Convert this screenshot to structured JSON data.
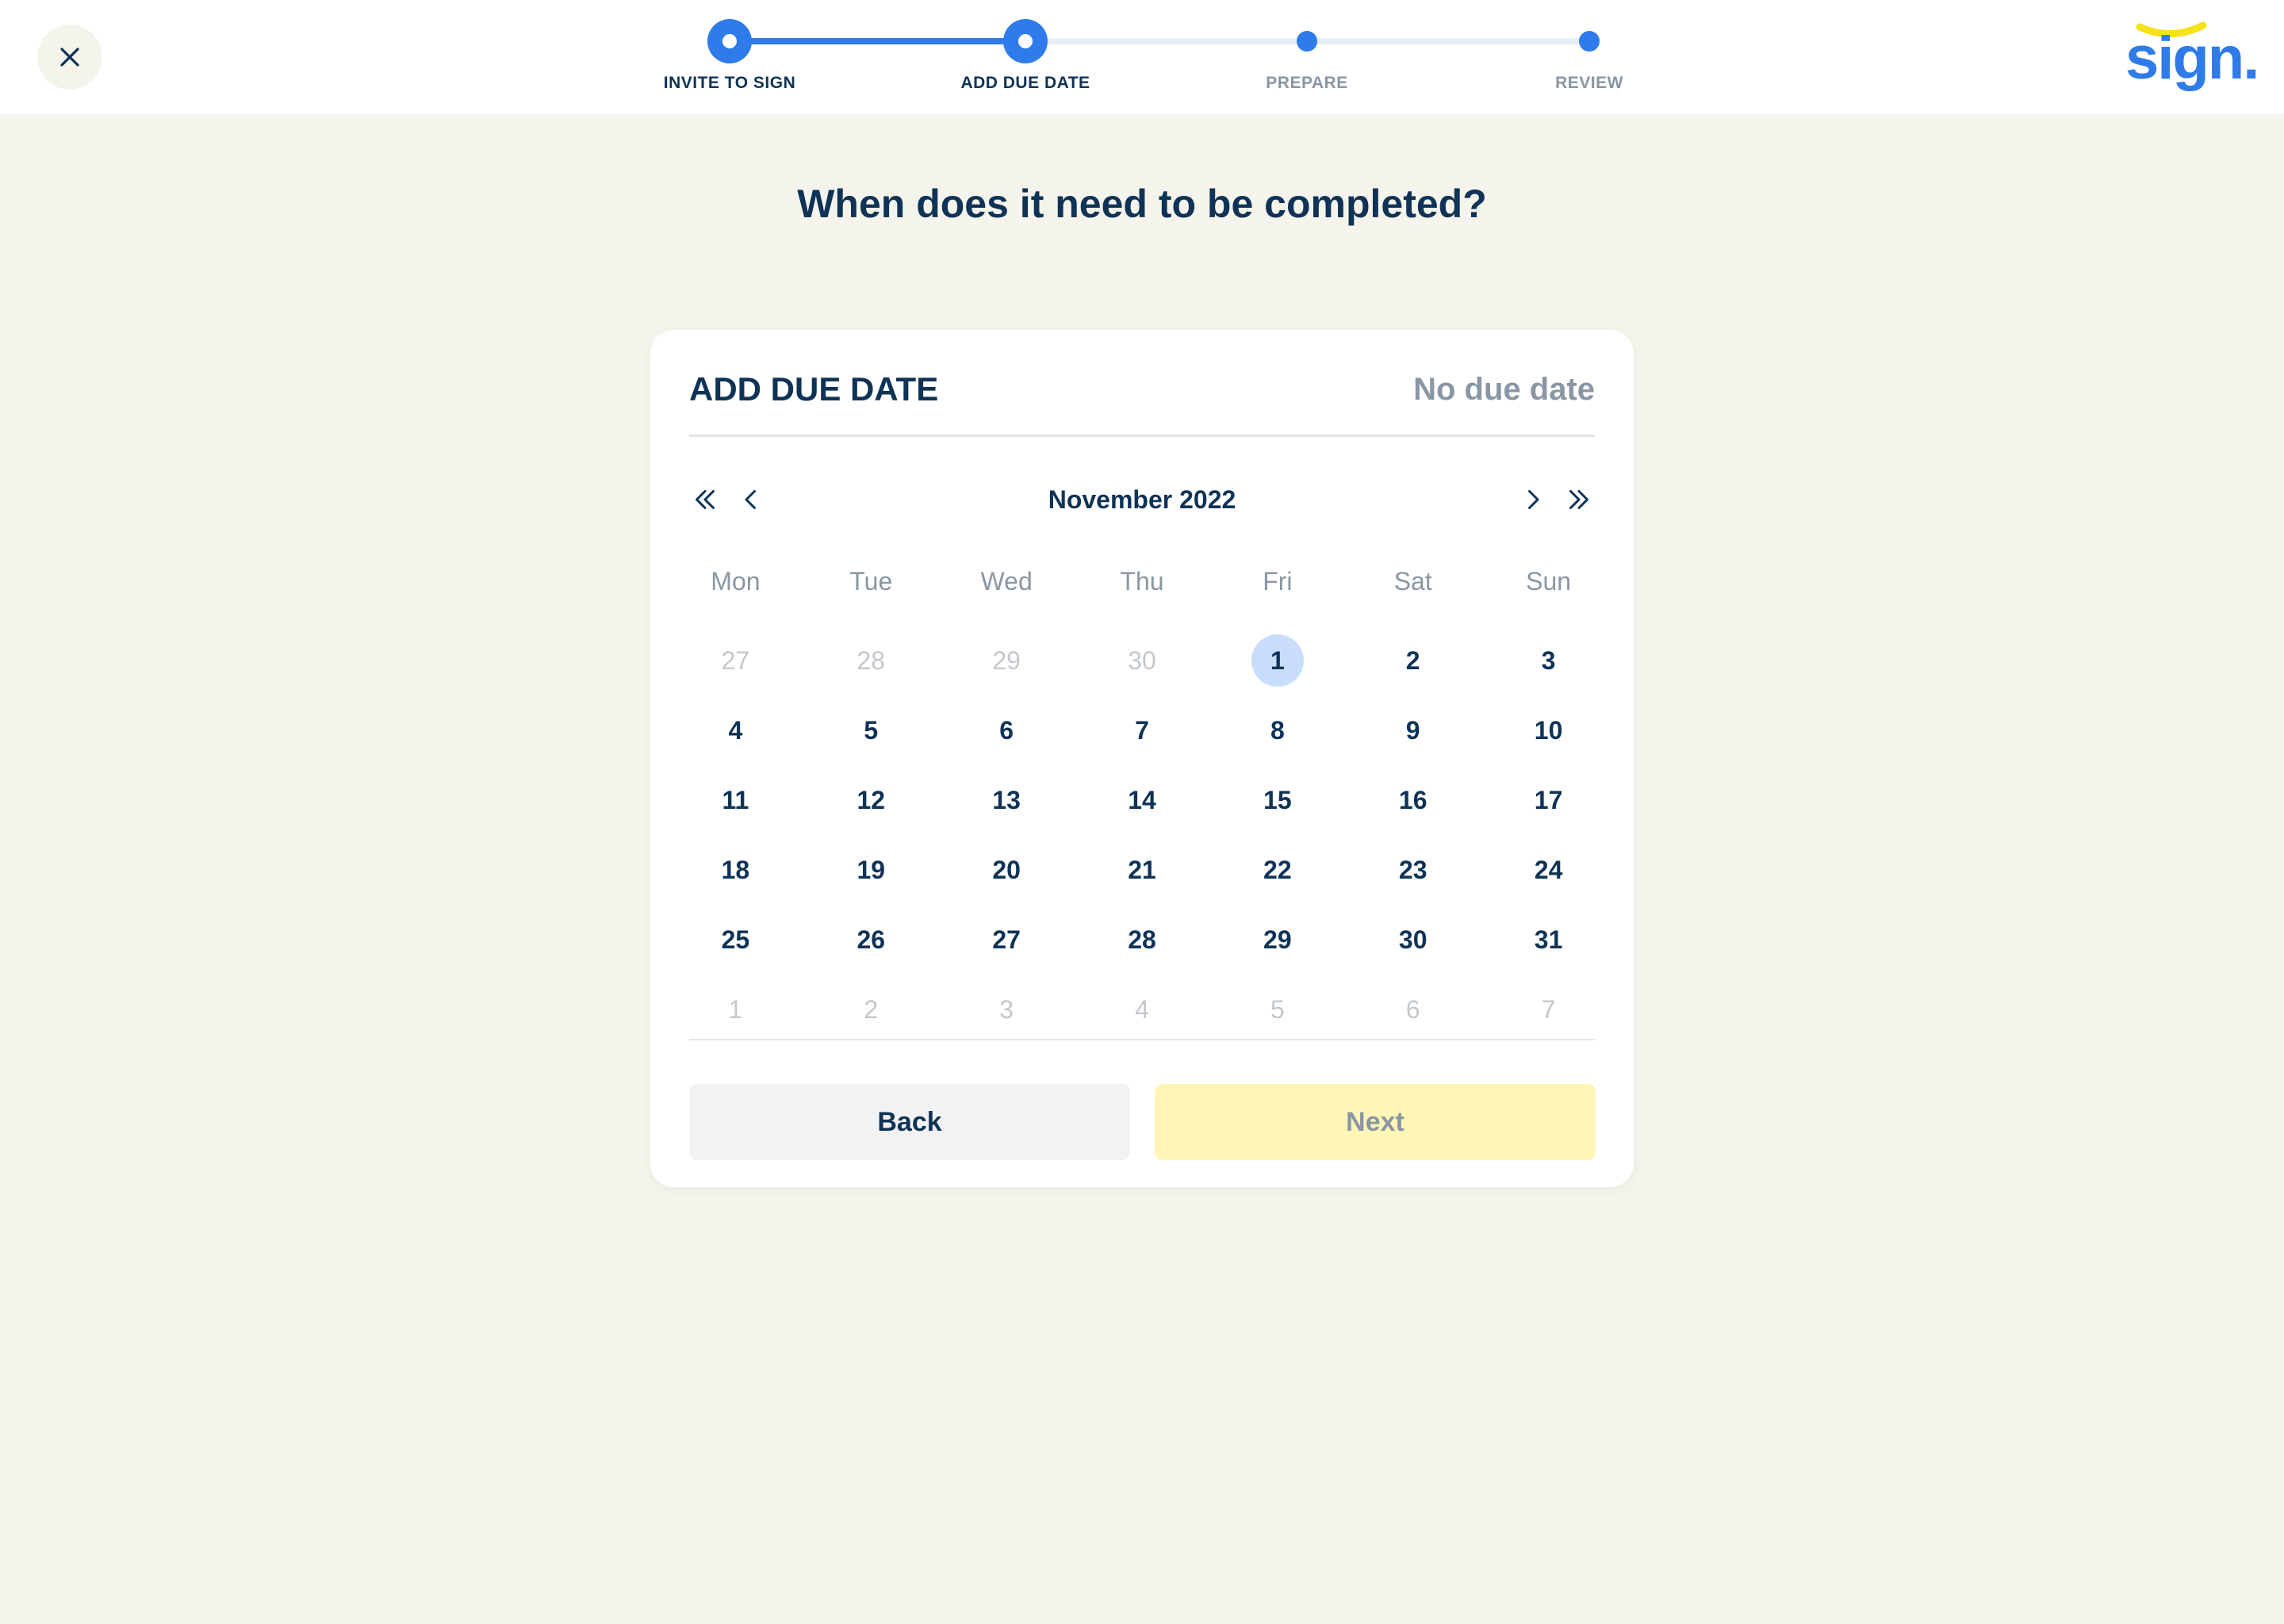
{
  "stepper": {
    "steps": [
      {
        "label": "INVITE TO SIGN",
        "state": "done"
      },
      {
        "label": "ADD DUE DATE",
        "state": "current"
      },
      {
        "label": "PREPARE",
        "state": "todo"
      },
      {
        "label": "REVIEW",
        "state": "todo"
      }
    ]
  },
  "logo": {
    "text": "sign."
  },
  "page": {
    "title": "When does it need to be completed?"
  },
  "card": {
    "title": "ADD DUE DATE",
    "no_due_date": "No due date"
  },
  "calendar": {
    "month_label": "November 2022",
    "weekdays": [
      "Mon",
      "Tue",
      "Wed",
      "Thu",
      "Fri",
      "Sat",
      "Sun"
    ],
    "days": [
      {
        "n": "27",
        "muted": true
      },
      {
        "n": "28",
        "muted": true
      },
      {
        "n": "29",
        "muted": true
      },
      {
        "n": "30",
        "muted": true
      },
      {
        "n": "1",
        "today": true
      },
      {
        "n": "2"
      },
      {
        "n": "3"
      },
      {
        "n": "4"
      },
      {
        "n": "5"
      },
      {
        "n": "6"
      },
      {
        "n": "7"
      },
      {
        "n": "8"
      },
      {
        "n": "9"
      },
      {
        "n": "10"
      },
      {
        "n": "11"
      },
      {
        "n": "12"
      },
      {
        "n": "13"
      },
      {
        "n": "14"
      },
      {
        "n": "15"
      },
      {
        "n": "16"
      },
      {
        "n": "17"
      },
      {
        "n": "18"
      },
      {
        "n": "19"
      },
      {
        "n": "20"
      },
      {
        "n": "21"
      },
      {
        "n": "22"
      },
      {
        "n": "23"
      },
      {
        "n": "24"
      },
      {
        "n": "25"
      },
      {
        "n": "26"
      },
      {
        "n": "27"
      },
      {
        "n": "28"
      },
      {
        "n": "29"
      },
      {
        "n": "30"
      },
      {
        "n": "31"
      },
      {
        "n": "1",
        "muted": true
      },
      {
        "n": "2",
        "muted": true
      },
      {
        "n": "3",
        "muted": true
      },
      {
        "n": "4",
        "muted": true
      },
      {
        "n": "5",
        "muted": true
      },
      {
        "n": "6",
        "muted": true
      },
      {
        "n": "7",
        "muted": true
      }
    ]
  },
  "buttons": {
    "back": "Back",
    "next": "Next"
  },
  "colors": {
    "accent": "#2f7bea",
    "navy": "#0f3356",
    "muted": "#8a96a3",
    "background": "#f5f4ec",
    "next_disabled": "#fef5b6",
    "logo_smile": "#f6e11a"
  },
  "icons": {
    "close": "close-icon",
    "prev_year": "double-chevron-left-icon",
    "prev_month": "chevron-left-icon",
    "next_month": "chevron-right-icon",
    "next_year": "double-chevron-right-icon"
  }
}
